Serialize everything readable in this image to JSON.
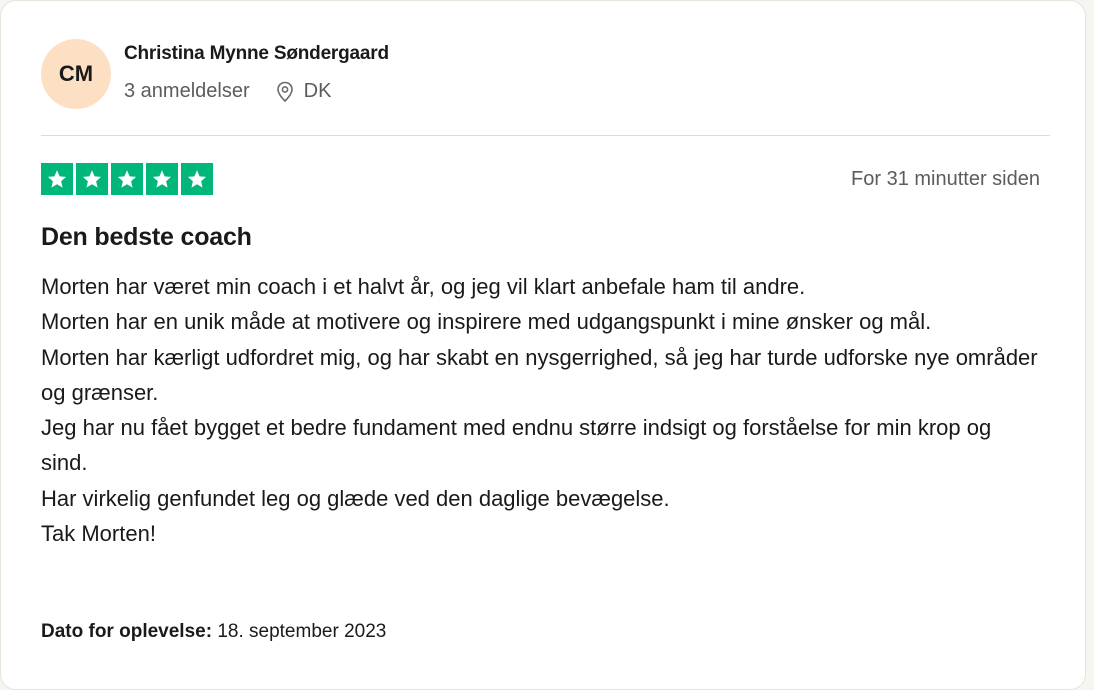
{
  "reviewer": {
    "initials": "CM",
    "name": "Christina Mynne Søndergaard",
    "reviews_count": "3 anmeldelser",
    "country": "DK",
    "avatar_color": "#fde0c4"
  },
  "review": {
    "rating": 5,
    "star_color": "#00b67a",
    "time_ago": "For 31 minutter siden",
    "title": "Den bedste coach",
    "lines": [
      "Morten har været min coach i et halvt år, og jeg vil klart anbefale ham til andre.",
      "Morten har en unik måde at motivere og inspirere med udgangspunkt i mine ønsker og mål.",
      "Morten har kærligt udfordret mig, og har skabt en nysgerrighed, så jeg har turde udforske nye områder og grænser.",
      "Jeg har nu fået bygget et bedre fundament med endnu større indsigt og forståelse for min krop og sind.",
      "Har virkelig genfundet leg og glæde ved den daglige bevægelse.",
      "Tak Morten!"
    ],
    "date_label": "Dato for oplevelse:",
    "date_value": "18. september 2023"
  }
}
